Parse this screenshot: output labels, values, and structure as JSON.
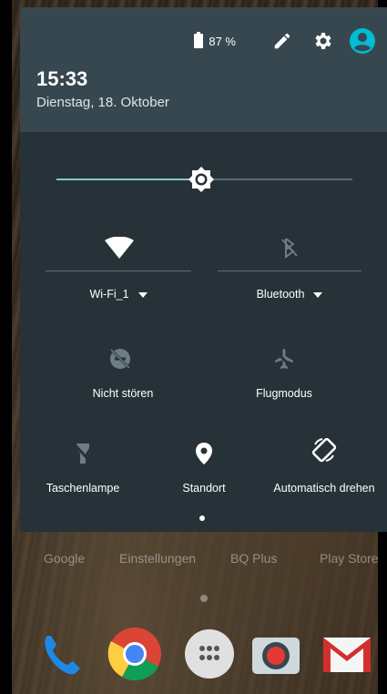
{
  "home": {
    "apps": [
      "Google",
      "Einstellungen",
      "BQ Plus",
      "Play Store"
    ]
  },
  "status": {
    "battery": "87 %",
    "time": "15:33",
    "date": "Dienstag, 18. Oktober"
  },
  "brightness": {
    "level": 0.49
  },
  "tiles": {
    "wifi": {
      "label": "Wi-Fi_1",
      "icon": "wifi-icon"
    },
    "bluetooth": {
      "label": "Bluetooth",
      "icon": "bluetooth-off-icon"
    },
    "dnd": {
      "label": "Nicht stören",
      "icon": "do-not-disturb-off-icon"
    },
    "airplane": {
      "label": "Flugmodus",
      "icon": "airplane-off-icon"
    },
    "flashlight": {
      "label": "Taschenlampe",
      "icon": "flashlight-off-icon"
    },
    "location": {
      "label": "Standort",
      "icon": "location-icon"
    },
    "rotate": {
      "label": "Automatisch drehen",
      "icon": "auto-rotate-icon"
    }
  },
  "colors": {
    "shade": "#263238",
    "header": "#37474f",
    "accent": "#80cbc4",
    "avatar": "#00bcd4"
  }
}
